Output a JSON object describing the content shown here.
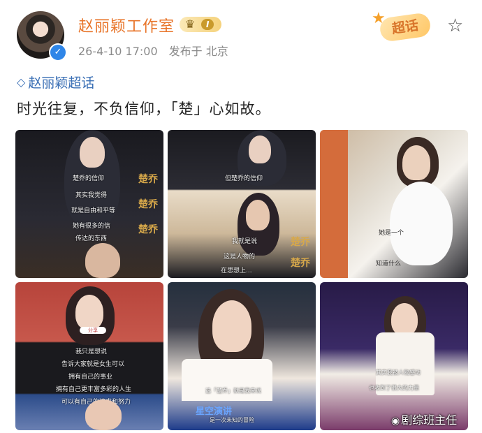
{
  "post": {
    "author": "赵丽颖工作室",
    "level_badge": "I",
    "timestamp": "26-4-10 17:00",
    "location": "发布于 北京",
    "supertopic_badge": "超话",
    "topic": "赵丽颖超话",
    "text": "时光往复，不负信仰，「楚」心如故。"
  },
  "images": [
    {
      "captions": [
        "楚乔的信仰",
        "其实我觉得",
        "就是自由和平等",
        "她有很多的信",
        "传达的东西"
      ],
      "title_glyph": "楚乔"
    },
    {
      "captions": [
        "但楚乔的信仰",
        "我就是说",
        "这是人物的",
        "在思想上..."
      ],
      "title_glyph": "楚乔"
    },
    {
      "captions": [
        "她是一个",
        "知道什么"
      ]
    },
    {
      "captions": [
        "我只是想说",
        "告诉大家就是女生可以",
        "拥有自己的事业",
        "拥有自己更丰富多彩的人生",
        "可以有自己的追求和努力"
      ],
      "tag": "分享"
    },
    {
      "captions": [
        "选「楚乔」就是我来说",
        "是一次未知的冒险"
      ],
      "banner": "星空演讲"
    },
    {
      "captions": [
        "其实我被人物感动",
        "也收到了很大的力量"
      ]
    }
  ],
  "watermark": "剧综班主任",
  "colors": {
    "author": "#e8752a",
    "topic": "#3a6fb5",
    "meta": "#8a8a8a"
  }
}
